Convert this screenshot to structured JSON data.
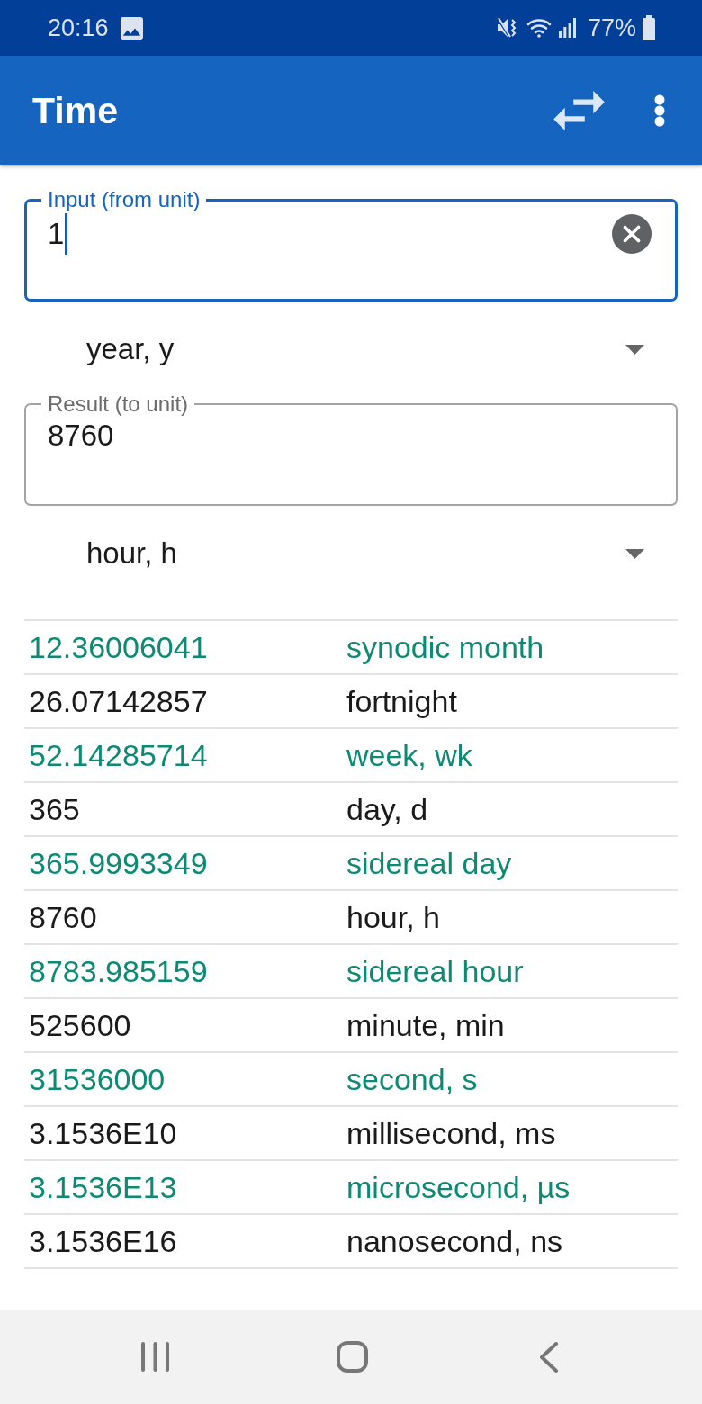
{
  "status_bar": {
    "time": "20:16",
    "battery": "77%"
  },
  "app_bar": {
    "title": "Time"
  },
  "input": {
    "label": "Input (from unit)",
    "value": "1",
    "focused": true
  },
  "from_unit": {
    "value": "year, y"
  },
  "result": {
    "label": "Result (to unit)",
    "value": "8760",
    "focused": false
  },
  "to_unit": {
    "value": "hour, h"
  },
  "results_table": {
    "rows": [
      {
        "value": "12.36006041",
        "unit": "synodic month",
        "color": "#0e8a74"
      },
      {
        "value": "26.07142857",
        "unit": "fortnight",
        "color": "#1a1a1a"
      },
      {
        "value": "52.14285714",
        "unit": "week, wk",
        "color": "#0e8a74"
      },
      {
        "value": "365",
        "unit": "day, d",
        "color": "#1a1a1a"
      },
      {
        "value": "365.9993349",
        "unit": "sidereal day",
        "color": "#0e8a74"
      },
      {
        "value": "8760",
        "unit": "hour, h",
        "color": "#1a1a1a"
      },
      {
        "value": "8783.985159",
        "unit": "sidereal hour",
        "color": "#0e8a74"
      },
      {
        "value": "525600",
        "unit": "minute, min",
        "color": "#1a1a1a"
      },
      {
        "value": "31536000",
        "unit": "second, s",
        "color": "#0e8a74"
      },
      {
        "value": "3.1536E10",
        "unit": "millisecond, ms",
        "color": "#1a1a1a"
      },
      {
        "value": "3.1536E13",
        "unit": "microsecond, µs",
        "color": "#0e8a74"
      },
      {
        "value": "3.1536E16",
        "unit": "nanosecond, ns",
        "color": "#1a1a1a"
      }
    ]
  }
}
